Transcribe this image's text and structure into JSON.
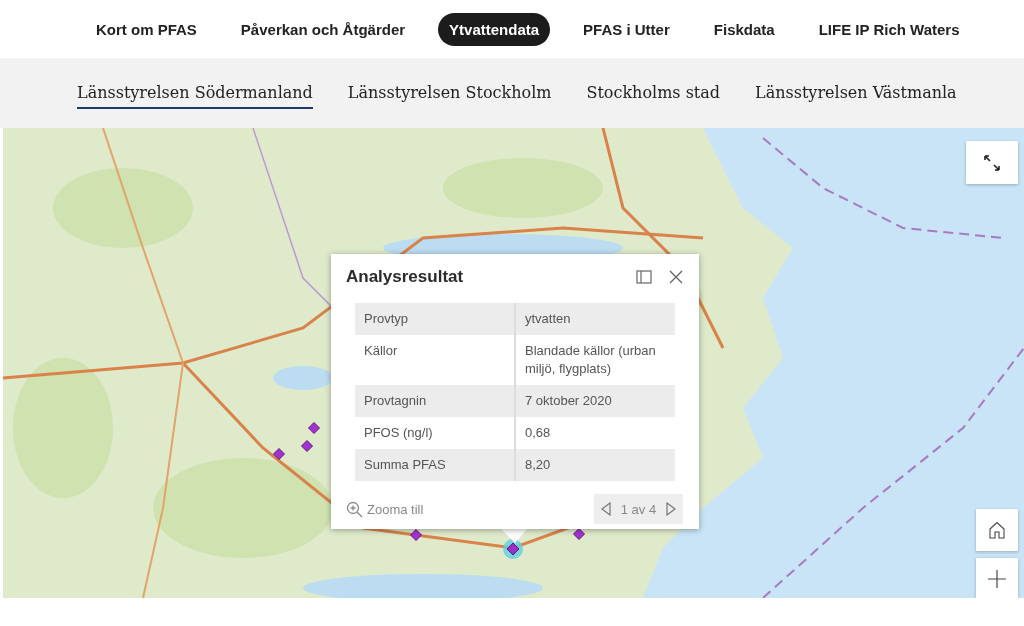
{
  "top_nav": {
    "items": [
      {
        "label": "Kort om PFAS",
        "selected": false
      },
      {
        "label": "Påverkan och Åtgärder",
        "selected": false
      },
      {
        "label": "Ytvattendata",
        "selected": true
      },
      {
        "label": "PFAS i Utter",
        "selected": false
      },
      {
        "label": "Fiskdata",
        "selected": false
      },
      {
        "label": "LIFE IP Rich Waters",
        "selected": false
      }
    ]
  },
  "region_tabs": {
    "items": [
      {
        "label": "Länsstyrelsen Södermanland",
        "selected": true
      },
      {
        "label": "Länsstyrelsen Stockholm",
        "selected": false
      },
      {
        "label": "Stockholms stad",
        "selected": false
      },
      {
        "label": "Länsstyrelsen Västmanla",
        "selected": false
      }
    ]
  },
  "map": {
    "markers": [
      {
        "selected": false
      },
      {
        "selected": false
      },
      {
        "selected": false
      },
      {
        "selected": false
      },
      {
        "selected": false
      },
      {
        "selected": true
      }
    ],
    "popup": {
      "title": "Analysresultat",
      "rows": [
        {
          "field": "Provtyp",
          "value": "ytvatten"
        },
        {
          "field": "Källor",
          "value": "Blandade källor (urban miljö, flygplats)"
        },
        {
          "field": "Provtagnin",
          "value": "7 oktober 2020"
        },
        {
          "field": "PFOS (ng/l)",
          "value": "0,68"
        },
        {
          "field": "Summa PFAS",
          "value": "8,20"
        }
      ],
      "zoom_link": "Zooma till",
      "pager": "1 av 4"
    }
  }
}
